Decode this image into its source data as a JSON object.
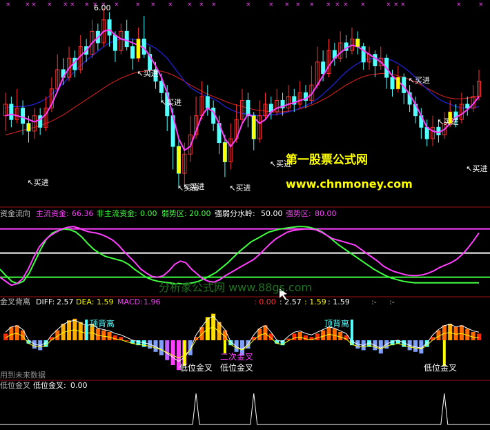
{
  "colors": {
    "bg": "#000000",
    "up": "#ff3030",
    "down": "#54ffff",
    "ma_short": "#ff40ff",
    "ma_mid": "#2020c8",
    "ma_long": "#c02020",
    "yellow": "#ffff00",
    "white": "#ffffff",
    "green": "#40ff40",
    "magenta": "#ff40ff",
    "separator": "#a01010"
  },
  "price_panel": {
    "max_label": "6.00",
    "buy_label": "买进",
    "buy_signals": [
      "买进",
      "买进",
      "买进",
      "买进",
      "买进",
      "买进",
      "买进",
      "买进",
      "买进",
      "买进"
    ],
    "watermark_title": "第一股票公式网",
    "watermark_url": "www.chnmoney.com"
  },
  "fund_panel": {
    "title": "资金流向",
    "main_label": "主流资金:",
    "main_value": "66.36",
    "nonmain_label": "非主流资金:",
    "nonmain_value": "0.00",
    "weak_label": "弱势区:",
    "weak_value": "20.00",
    "divide_label": "强弱分水岭:",
    "divide_value": "50.00",
    "strong_label": "强势区:",
    "strong_value": "80.00",
    "watermark": "分析家公式网 www.88gs.com"
  },
  "macd_panel": {
    "title": "金叉背离",
    "diff_label": "DIFF:",
    "diff_value": "2.57",
    "dea_label": "DEA:",
    "dea_value": "1.59",
    "macd_label": "MACD:",
    "macd_value": "1.96",
    "extra1": ": 0.00",
    "extra2": ": 2.57",
    "extra3": ": 1.59",
    "extra4": ": 1.59",
    "extra5": ":-",
    "extra6": ":-",
    "top_div_1": "顶背离",
    "top_div_2": "顶背离",
    "low_cross_1": "低位金叉",
    "low_cross_2": "低位金叉",
    "second_cross": "二次金叉",
    "low_cross_3": "低位金叉",
    "future_note": "用到未来数据"
  },
  "signal_panel": {
    "title": "低位金叉",
    "label": "低位金叉:",
    "value": "0.00"
  },
  "chart_data": {
    "type": "line",
    "ylim": [
      3.5,
      6.0
    ],
    "candles": [
      {
        "o": 4.6,
        "c": 4.75,
        "h": 4.9,
        "l": 4.4
      },
      {
        "o": 4.75,
        "c": 4.55,
        "h": 4.85,
        "l": 4.45
      },
      {
        "o": 4.55,
        "c": 4.7,
        "h": 4.95,
        "l": 4.5
      },
      {
        "o": 4.7,
        "c": 4.5,
        "h": 4.8,
        "l": 4.35
      },
      {
        "o": 4.5,
        "c": 4.4,
        "h": 4.6,
        "l": 4.25
      },
      {
        "o": 4.4,
        "c": 4.6,
        "h": 4.7,
        "l": 4.3
      },
      {
        "o": 4.6,
        "c": 4.45,
        "h": 4.7,
        "l": 4.35
      },
      {
        "o": 4.45,
        "c": 4.7,
        "h": 4.85,
        "l": 4.4
      },
      {
        "o": 4.7,
        "c": 4.95,
        "h": 5.1,
        "l": 4.65
      },
      {
        "o": 4.95,
        "c": 5.2,
        "h": 5.4,
        "l": 4.9
      },
      {
        "o": 5.2,
        "c": 5.1,
        "h": 5.35,
        "l": 5.0
      },
      {
        "o": 5.1,
        "c": 5.35,
        "h": 5.5,
        "l": 5.05
      },
      {
        "o": 5.35,
        "c": 5.2,
        "h": 5.45,
        "l": 5.1
      },
      {
        "o": 5.2,
        "c": 5.5,
        "h": 5.65,
        "l": 5.15
      },
      {
        "o": 5.5,
        "c": 5.4,
        "h": 5.6,
        "l": 5.3
      },
      {
        "o": 5.4,
        "c": 5.7,
        "h": 5.85,
        "l": 5.35
      },
      {
        "o": 5.7,
        "c": 5.55,
        "h": 5.8,
        "l": 5.45
      },
      {
        "o": 5.55,
        "c": 5.85,
        "h": 6.0,
        "l": 5.5
      },
      {
        "o": 5.85,
        "c": 5.65,
        "h": 5.95,
        "l": 5.5
      },
      {
        "o": 5.65,
        "c": 5.45,
        "h": 5.7,
        "l": 5.3
      },
      {
        "o": 5.45,
        "c": 5.7,
        "h": 5.8,
        "l": 5.4
      },
      {
        "o": 5.7,
        "c": 5.5,
        "h": 5.85,
        "l": 5.45
      },
      {
        "o": 5.5,
        "c": 5.35,
        "h": 5.6,
        "l": 5.2
      },
      {
        "o": 5.35,
        "c": 5.6,
        "h": 5.75,
        "l": 5.3
      },
      {
        "o": 5.6,
        "c": 5.4,
        "h": 5.9,
        "l": 5.35
      },
      {
        "o": 5.4,
        "c": 5.2,
        "h": 5.5,
        "l": 5.1
      },
      {
        "o": 5.2,
        "c": 5.05,
        "h": 5.3,
        "l": 4.95
      },
      {
        "o": 5.05,
        "c": 4.9,
        "h": 5.15,
        "l": 4.8
      },
      {
        "o": 4.9,
        "c": 4.6,
        "h": 5.0,
        "l": 4.4
      },
      {
        "o": 4.6,
        "c": 4.2,
        "h": 4.7,
        "l": 3.9
      },
      {
        "o": 4.2,
        "c": 3.85,
        "h": 4.3,
        "l": 3.65
      },
      {
        "o": 3.85,
        "c": 4.1,
        "h": 4.25,
        "l": 3.7
      },
      {
        "o": 4.1,
        "c": 4.35,
        "h": 4.6,
        "l": 4.0
      },
      {
        "o": 4.35,
        "c": 4.6,
        "h": 4.85,
        "l": 4.3
      },
      {
        "o": 4.6,
        "c": 4.85,
        "h": 5.05,
        "l": 4.55
      },
      {
        "o": 4.85,
        "c": 4.7,
        "h": 5.0,
        "l": 4.6
      },
      {
        "o": 4.7,
        "c": 4.5,
        "h": 4.8,
        "l": 4.4
      },
      {
        "o": 4.5,
        "c": 4.25,
        "h": 4.6,
        "l": 4.1
      },
      {
        "o": 4.25,
        "c": 4.0,
        "h": 4.35,
        "l": 3.8
      },
      {
        "o": 4.0,
        "c": 4.3,
        "h": 4.5,
        "l": 3.9
      },
      {
        "o": 4.3,
        "c": 4.55,
        "h": 4.75,
        "l": 4.25
      },
      {
        "o": 4.55,
        "c": 4.8,
        "h": 4.95,
        "l": 4.5
      },
      {
        "o": 4.8,
        "c": 4.6,
        "h": 4.9,
        "l": 4.45
      },
      {
        "o": 4.6,
        "c": 4.3,
        "h": 4.65,
        "l": 4.15
      },
      {
        "o": 4.3,
        "c": 4.6,
        "h": 4.8,
        "l": 4.25
      },
      {
        "o": 4.6,
        "c": 4.75,
        "h": 4.9,
        "l": 4.55
      },
      {
        "o": 4.75,
        "c": 4.65,
        "h": 4.85,
        "l": 4.55
      },
      {
        "o": 4.65,
        "c": 4.8,
        "h": 4.95,
        "l": 4.6
      },
      {
        "o": 4.8,
        "c": 4.7,
        "h": 4.9,
        "l": 4.6
      },
      {
        "o": 4.7,
        "c": 4.85,
        "h": 5.0,
        "l": 4.65
      },
      {
        "o": 4.85,
        "c": 4.75,
        "h": 4.95,
        "l": 4.65
      },
      {
        "o": 4.75,
        "c": 4.9,
        "h": 5.05,
        "l": 4.7
      },
      {
        "o": 4.9,
        "c": 4.8,
        "h": 5.0,
        "l": 4.7
      },
      {
        "o": 4.8,
        "c": 5.0,
        "h": 5.25,
        "l": 4.75
      },
      {
        "o": 5.0,
        "c": 5.3,
        "h": 5.5,
        "l": 4.95
      },
      {
        "o": 5.3,
        "c": 5.15,
        "h": 5.45,
        "l": 5.05
      },
      {
        "o": 5.15,
        "c": 5.45,
        "h": 5.6,
        "l": 5.1
      },
      {
        "o": 5.45,
        "c": 5.35,
        "h": 5.55,
        "l": 5.25
      },
      {
        "o": 5.35,
        "c": 5.55,
        "h": 5.7,
        "l": 5.3
      },
      {
        "o": 5.55,
        "c": 5.45,
        "h": 5.65,
        "l": 5.35
      },
      {
        "o": 5.45,
        "c": 5.6,
        "h": 5.75,
        "l": 5.4
      },
      {
        "o": 5.6,
        "c": 5.5,
        "h": 5.7,
        "l": 5.4
      },
      {
        "o": 5.5,
        "c": 5.3,
        "h": 5.55,
        "l": 5.2
      },
      {
        "o": 5.3,
        "c": 5.4,
        "h": 5.5,
        "l": 5.2
      },
      {
        "o": 5.4,
        "c": 5.25,
        "h": 5.45,
        "l": 5.1
      },
      {
        "o": 5.25,
        "c": 5.35,
        "h": 5.5,
        "l": 5.2
      },
      {
        "o": 5.35,
        "c": 5.1,
        "h": 5.4,
        "l": 4.95
      },
      {
        "o": 5.1,
        "c": 4.95,
        "h": 5.2,
        "l": 4.85
      },
      {
        "o": 4.95,
        "c": 5.1,
        "h": 5.25,
        "l": 4.9
      },
      {
        "o": 5.1,
        "c": 4.9,
        "h": 5.15,
        "l": 4.75
      },
      {
        "o": 4.9,
        "c": 4.75,
        "h": 5.0,
        "l": 4.65
      },
      {
        "o": 4.75,
        "c": 4.6,
        "h": 4.85,
        "l": 4.5
      },
      {
        "o": 4.6,
        "c": 4.45,
        "h": 4.7,
        "l": 4.3
      },
      {
        "o": 4.45,
        "c": 4.3,
        "h": 4.55,
        "l": 4.2
      },
      {
        "o": 4.3,
        "c": 4.45,
        "h": 4.6,
        "l": 4.2
      },
      {
        "o": 4.45,
        "c": 4.35,
        "h": 4.55,
        "l": 4.25
      },
      {
        "o": 4.35,
        "c": 4.5,
        "h": 4.65,
        "l": 4.3
      },
      {
        "o": 4.5,
        "c": 4.65,
        "h": 4.8,
        "l": 4.45
      },
      {
        "o": 4.65,
        "c": 4.55,
        "h": 4.75,
        "l": 4.45
      },
      {
        "o": 4.55,
        "c": 4.75,
        "h": 4.9,
        "l": 4.5
      },
      {
        "o": 4.75,
        "c": 4.7,
        "h": 4.85,
        "l": 4.6
      },
      {
        "o": 4.7,
        "c": 4.85,
        "h": 5.0,
        "l": 4.65
      },
      {
        "o": 4.85,
        "c": 5.05,
        "h": 5.2,
        "l": 4.8
      }
    ],
    "ma_short": [
      4.6,
      4.62,
      4.6,
      4.58,
      4.55,
      4.52,
      4.55,
      4.62,
      4.75,
      4.92,
      5.1,
      5.22,
      5.3,
      5.38,
      5.45,
      5.55,
      5.62,
      5.7,
      5.72,
      5.65,
      5.6,
      5.58,
      5.55,
      5.52,
      5.48,
      5.38,
      5.25,
      5.1,
      4.9,
      4.6,
      4.3,
      4.15,
      4.2,
      4.4,
      4.6,
      4.7,
      4.65,
      4.5,
      4.3,
      4.2,
      4.3,
      4.5,
      4.62,
      4.58,
      4.5,
      4.55,
      4.65,
      4.7,
      4.72,
      4.75,
      4.77,
      4.8,
      4.82,
      4.88,
      5.0,
      5.12,
      5.25,
      5.35,
      5.42,
      5.48,
      5.52,
      5.5,
      5.45,
      5.4,
      5.35,
      5.3,
      5.22,
      5.12,
      5.05,
      4.98,
      4.88,
      4.75,
      4.6,
      4.45,
      4.4,
      4.38,
      4.42,
      4.5,
      4.58,
      4.62,
      4.68,
      4.75,
      4.85
    ],
    "ma_mid": [
      4.7,
      4.72,
      4.72,
      4.72,
      4.73,
      4.75,
      4.78,
      4.82,
      4.88,
      4.95,
      5.02,
      5.1,
      5.18,
      5.25,
      5.32,
      5.38,
      5.44,
      5.5,
      5.55,
      5.58,
      5.6,
      5.6,
      5.6,
      5.58,
      5.56,
      5.52,
      5.48,
      5.42,
      5.35,
      5.25,
      5.15,
      5.05,
      4.97,
      4.92,
      4.88,
      4.85,
      4.82,
      4.78,
      4.72,
      4.68,
      4.65,
      4.63,
      4.62,
      4.61,
      4.6,
      4.6,
      4.61,
      4.62,
      4.63,
      4.65,
      4.67,
      4.7,
      4.73,
      4.77,
      4.82,
      4.88,
      4.95,
      5.02,
      5.1,
      5.17,
      5.23,
      5.28,
      5.32,
      5.34,
      5.35,
      5.35,
      5.34,
      5.32,
      5.28,
      5.23,
      5.17,
      5.1,
      5.02,
      4.95,
      4.88,
      4.82,
      4.78,
      4.75,
      4.72,
      4.7,
      4.7,
      4.7,
      4.72
    ],
    "ma_long": [
      4.35,
      4.37,
      4.39,
      4.41,
      4.43,
      4.45,
      4.47,
      4.5,
      4.53,
      4.57,
      4.61,
      4.66,
      4.71,
      4.76,
      4.81,
      4.86,
      4.91,
      4.96,
      5.01,
      5.05,
      5.09,
      5.12,
      5.15,
      5.17,
      5.18,
      5.19,
      5.19,
      5.18,
      5.16,
      5.13,
      5.09,
      5.05,
      5.0,
      4.96,
      4.92,
      4.88,
      4.85,
      4.82,
      4.79,
      4.76,
      4.74,
      4.72,
      4.7,
      4.68,
      4.67,
      4.66,
      4.65,
      4.65,
      4.65,
      4.66,
      4.67,
      4.69,
      4.71,
      4.74,
      4.77,
      4.81,
      4.85,
      4.9,
      4.95,
      5.0,
      5.04,
      5.08,
      5.11,
      5.13,
      5.14,
      5.15,
      5.15,
      5.14,
      5.12,
      5.1,
      5.07,
      5.04,
      5.0,
      4.96,
      4.92,
      4.88,
      4.85,
      4.83,
      4.82,
      4.82,
      4.83,
      4.84,
      4.86
    ],
    "fund_main": [
      30,
      22,
      15,
      12,
      15,
      25,
      40,
      55,
      68,
      75,
      78,
      80,
      79,
      76,
      70,
      62,
      55,
      50,
      46,
      44,
      42,
      40,
      36,
      30,
      25,
      20,
      17,
      15,
      14,
      13,
      12,
      12,
      12,
      13,
      15,
      18,
      22,
      26,
      32,
      38,
      45,
      52,
      58,
      64,
      68,
      72,
      76,
      78,
      80,
      81,
      82,
      83,
      83,
      82,
      80,
      77,
      72,
      66,
      60,
      55,
      50,
      45,
      40,
      35,
      30,
      26,
      22,
      19,
      17,
      15,
      14,
      13,
      13,
      13,
      13,
      13,
      13,
      13,
      13,
      13,
      13,
      13,
      13
    ],
    "fund_non": [
      20,
      15,
      10,
      12,
      18,
      30,
      45,
      58,
      66,
      72,
      76,
      80,
      82,
      83,
      81,
      78,
      76,
      75,
      73,
      70,
      66,
      60,
      52,
      45,
      38,
      30,
      25,
      21,
      20,
      22,
      28,
      36,
      40,
      38,
      30,
      24,
      18,
      15,
      14,
      17,
      22,
      26,
      30,
      34,
      38,
      42,
      48,
      55,
      62,
      68,
      72,
      76,
      78,
      79,
      80,
      80,
      79,
      76,
      72,
      68,
      66,
      64,
      62,
      60,
      55,
      50,
      45,
      40,
      34,
      30,
      27,
      25,
      23,
      22,
      22,
      23,
      25,
      28,
      32,
      35,
      38,
      42,
      48,
      56,
      65,
      75
    ],
    "fund_lines": {
      "weak": 20,
      "divide": 50,
      "strong": 80
    },
    "macd": [
      0.4,
      0.8,
      0.9,
      0.6,
      -0.2,
      -0.5,
      -0.6,
      -0.4,
      0.2,
      0.6,
      1.0,
      1.2,
      1.3,
      1.1,
      0.9,
      1.0,
      0.7,
      0.6,
      0.5,
      0.3,
      0.2,
      0.0,
      -0.2,
      -0.3,
      -0.4,
      -0.5,
      -0.7,
      -0.9,
      -1.2,
      -1.5,
      -1.8,
      -1.5,
      -0.9,
      0.2,
      0.8,
      1.4,
      1.6,
      1.1,
      0.6,
      -0.3,
      -0.7,
      -0.9,
      -0.5,
      0.2,
      0.7,
      0.9,
      0.4,
      -0.2,
      -0.3,
      0.1,
      0.4,
      0.5,
      0.3,
      0.2,
      0.4,
      0.6,
      0.8,
      0.7,
      0.5,
      0.3,
      -0.3,
      -0.5,
      -0.6,
      -0.4,
      -0.6,
      -0.8,
      -0.5,
      -0.3,
      -0.2,
      -0.4,
      -0.6,
      -0.7,
      -0.8,
      -0.4,
      0.2,
      0.6,
      0.9,
      1.0,
      0.8,
      0.9,
      0.7,
      0.5,
      0.4
    ],
    "signal_spikes": [
      33,
      43,
      76
    ]
  }
}
